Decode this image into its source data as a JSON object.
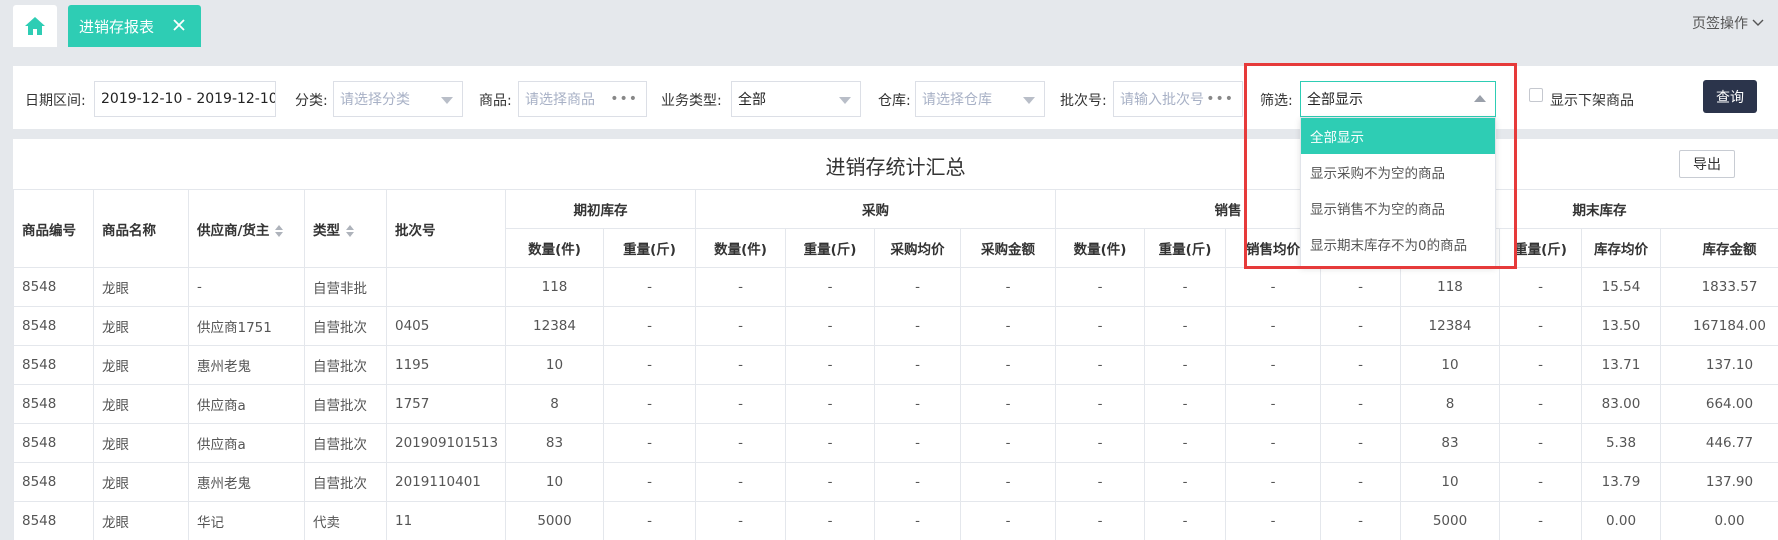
{
  "tabs": {
    "active_label": "进销存报表",
    "ops_label": "页签操作"
  },
  "filters": {
    "date_label": "日期区间:",
    "date_value": "2019-12-10 - 2019-12-10",
    "category_label": "分类:",
    "category_placeholder": "请选择分类",
    "product_label": "商品:",
    "product_placeholder": "请选择商品",
    "biz_type_label": "业务类型:",
    "biz_type_value": "全部",
    "warehouse_label": "仓库:",
    "warehouse_placeholder": "请选择仓库",
    "batch_label": "批次号:",
    "batch_placeholder": "请输入批次号",
    "screen_label": "筛选:",
    "screen_value": "全部显示",
    "show_offshelf_label": "显示下架商品",
    "query_label": "查询"
  },
  "dropdown": {
    "options": [
      "全部显示",
      "显示采购不为空的商品",
      "显示销售不为空的商品",
      "显示期末库存不为0的商品"
    ],
    "selected_index": 0
  },
  "panel": {
    "title": "进销存统计汇总",
    "export_label": "导出"
  },
  "table": {
    "top_headers": {
      "code": "商品编号",
      "name": "商品名称",
      "supplier": "供应商/货主",
      "type": "类型",
      "batch": "批次号",
      "opening": "期初库存",
      "purchase": "采购",
      "sales": "销售",
      "closing": "期末库存"
    },
    "sub_headers": {
      "qty": "数量(件)",
      "weight": "重量(斤)",
      "purchase_avg": "采购均价",
      "purchase_amount": "采购金额",
      "sales_avg": "销售均价",
      "stock_avg": "库存均价",
      "stock_amount": "库存金额"
    },
    "rows": [
      {
        "code": "8548",
        "name": "龙眼",
        "supplier": "-",
        "type": "自营非批",
        "batch": "",
        "open_qty": "118",
        "open_w": "-",
        "p_qty": "-",
        "p_w": "-",
        "p_avg": "-",
        "p_amt": "-",
        "s_qty": "-",
        "s_w": "-",
        "s_avg": "-",
        "s_amt": "-",
        "c_qty": "118",
        "c_w": "-",
        "c_avg": "15.54",
        "c_amt": "1833.57"
      },
      {
        "code": "8548",
        "name": "龙眼",
        "supplier": "供应商1751",
        "type": "自营批次",
        "batch": "0405",
        "open_qty": "12384",
        "open_w": "-",
        "p_qty": "-",
        "p_w": "-",
        "p_avg": "-",
        "p_amt": "-",
        "s_qty": "-",
        "s_w": "-",
        "s_avg": "-",
        "s_amt": "-",
        "c_qty": "12384",
        "c_w": "-",
        "c_avg": "13.50",
        "c_amt": "167184.00"
      },
      {
        "code": "8548",
        "name": "龙眼",
        "supplier": "惠州老鬼",
        "type": "自营批次",
        "batch": "1195",
        "open_qty": "10",
        "open_w": "-",
        "p_qty": "-",
        "p_w": "-",
        "p_avg": "-",
        "p_amt": "-",
        "s_qty": "-",
        "s_w": "-",
        "s_avg": "-",
        "s_amt": "-",
        "c_qty": "10",
        "c_w": "-",
        "c_avg": "13.71",
        "c_amt": "137.10"
      },
      {
        "code": "8548",
        "name": "龙眼",
        "supplier": "供应商a",
        "type": "自营批次",
        "batch": "1757",
        "open_qty": "8",
        "open_w": "-",
        "p_qty": "-",
        "p_w": "-",
        "p_avg": "-",
        "p_amt": "-",
        "s_qty": "-",
        "s_w": "-",
        "s_avg": "-",
        "s_amt": "-",
        "c_qty": "8",
        "c_w": "-",
        "c_avg": "83.00",
        "c_amt": "664.00"
      },
      {
        "code": "8548",
        "name": "龙眼",
        "supplier": "供应商a",
        "type": "自营批次",
        "batch": "201909101513",
        "open_qty": "83",
        "open_w": "-",
        "p_qty": "-",
        "p_w": "-",
        "p_avg": "-",
        "p_amt": "-",
        "s_qty": "-",
        "s_w": "-",
        "s_avg": "-",
        "s_amt": "-",
        "c_qty": "83",
        "c_w": "-",
        "c_avg": "5.38",
        "c_amt": "446.77"
      },
      {
        "code": "8548",
        "name": "龙眼",
        "supplier": "惠州老鬼",
        "type": "自营批次",
        "batch": "2019110401",
        "open_qty": "10",
        "open_w": "-",
        "p_qty": "-",
        "p_w": "-",
        "p_avg": "-",
        "p_amt": "-",
        "s_qty": "-",
        "s_w": "-",
        "s_avg": "-",
        "s_amt": "-",
        "c_qty": "10",
        "c_w": "-",
        "c_avg": "13.79",
        "c_amt": "137.90"
      },
      {
        "code": "8548",
        "name": "龙眼",
        "supplier": "华记",
        "type": "代卖",
        "batch": "11",
        "open_qty": "5000",
        "open_w": "-",
        "p_qty": "-",
        "p_w": "-",
        "p_avg": "-",
        "p_amt": "-",
        "s_qty": "-",
        "s_w": "-",
        "s_avg": "-",
        "s_amt": "-",
        "c_qty": "5000",
        "c_w": "-",
        "c_avg": "0.00",
        "c_amt": "0.00"
      }
    ]
  },
  "colors": {
    "accent": "#2ecdb4",
    "primary_button": "#2b344b",
    "highlight": "#e63a3a"
  }
}
